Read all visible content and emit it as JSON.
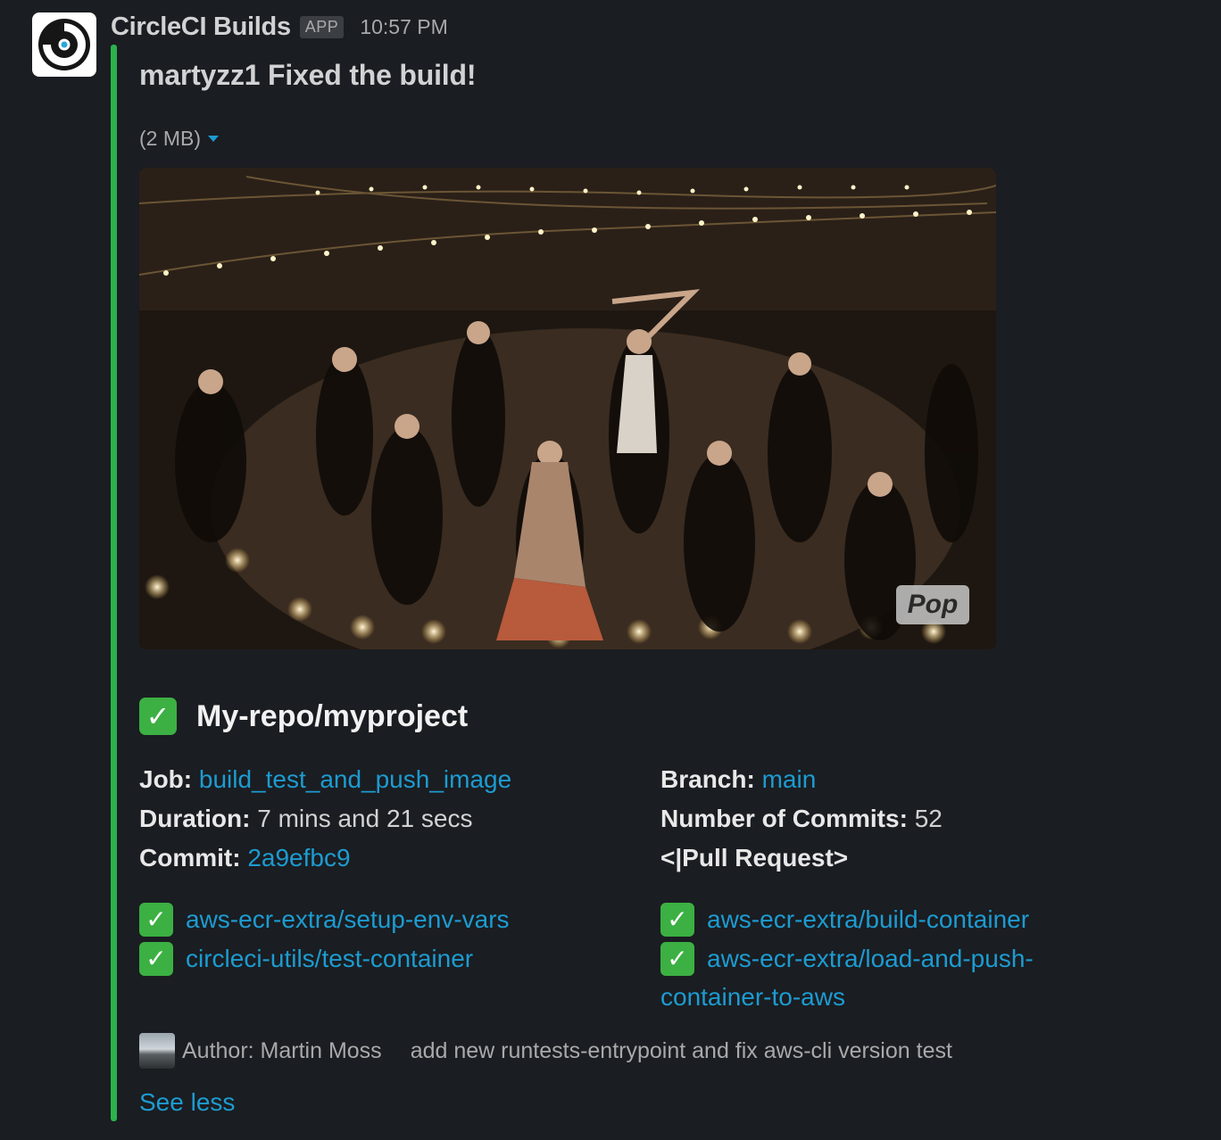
{
  "message": {
    "sender": "CircleCI Builds",
    "app_badge": "APP",
    "timestamp": "10:57 PM",
    "title": "martyzz1 Fixed the build!",
    "file_size": "(2 MB)",
    "gif_watermark": "Pop"
  },
  "build": {
    "repo": "My-repo/myproject",
    "job_label": "Job:",
    "job_value": "build_test_and_push_image",
    "branch_label": "Branch:",
    "branch_value": "main",
    "duration_label": "Duration:",
    "duration_value": "7 mins and 21 secs",
    "commits_label": "Number of Commits:",
    "commits_value": "52",
    "commit_label": "Commit:",
    "commit_value": "2a9efbc9",
    "pull_request": "<|Pull Request>"
  },
  "steps": {
    "left": [
      "aws-ecr-extra/setup-env-vars",
      "circleci-utils/test-container"
    ],
    "right_1": "aws-ecr-extra/build-container",
    "right_2_line1": "aws-ecr-extra/load-and-push-",
    "right_2_line2": "container-to-aws",
    "check_glyph": "✓"
  },
  "footer": {
    "author": "Author: Martin Moss",
    "commit_message": "add new runtests-entrypoint and fix aws-cli version test",
    "see_less": "See less"
  },
  "colors": {
    "background": "#1a1d21",
    "accent_bar": "#2bb24c",
    "link": "#1d9bd1",
    "check": "#3cb043"
  },
  "icons": [
    "circleci-logo-icon",
    "caret-down-icon",
    "check-mark-icon"
  ]
}
